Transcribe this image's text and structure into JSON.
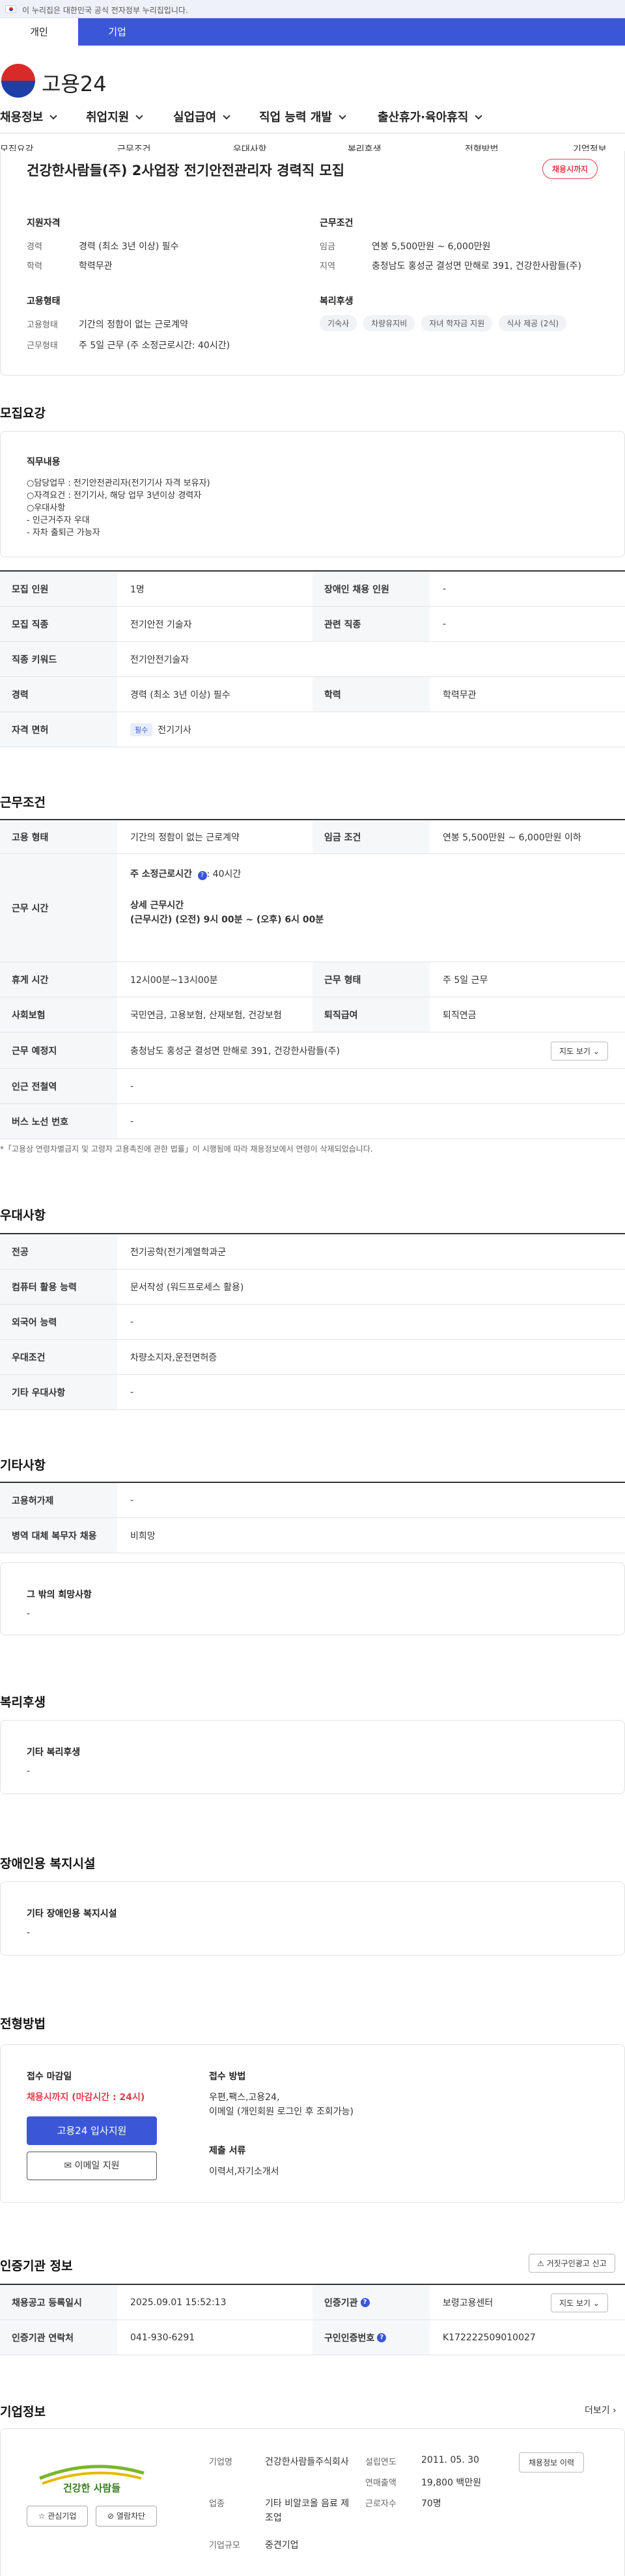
{
  "gov_banner": {
    "text": "이 누리집은 대한민국 공식 전자정부 누리집입니다."
  },
  "tabs": [
    {
      "label": "개인"
    },
    {
      "label": "기업"
    }
  ],
  "logo": {
    "text": "고용24"
  },
  "gnb": {
    "items": [
      {
        "label": "채용정보"
      },
      {
        "label": "취업지원"
      },
      {
        "label": "실업급여"
      },
      {
        "label": "직업 능력 개발"
      },
      {
        "label": "출산휴가·육아휴직"
      }
    ]
  },
  "subnav": {
    "items": [
      {
        "label": "모집요강"
      },
      {
        "label": "근무조건"
      },
      {
        "label": "우대사항"
      },
      {
        "label": "복리후생"
      },
      {
        "label": "전형방법"
      },
      {
        "label": "기업정보"
      }
    ]
  },
  "summary": {
    "title": "건강한사람들(주) 2사업장 전기안전관리자 경력직 모집",
    "status_badge": "채용시까지",
    "qualification": {
      "heading": "지원자격",
      "career_label": "경력",
      "career_value": "경력 (최소 3년 이상) 필수",
      "edu_label": "학력",
      "edu_value": "학력무관"
    },
    "conditions": {
      "heading": "근무조건",
      "wage_label": "임금",
      "wage_value": "연봉 5,500만원 ~ 6,000만원",
      "region_label": "지역",
      "region_value": "충청남도 홍성군 결성면 만해로 391, 건강한사람들(주)"
    },
    "employment": {
      "heading": "고용형태",
      "type_label": "고용형태",
      "type_value": "기간의 정함이 없는 근로계약",
      "form_label": "근무형태",
      "form_value": "주 5일 근무 (주 소정근로시간: 40시간)"
    },
    "welfare": {
      "heading": "복리후생",
      "tags": [
        "기숙사",
        "차량유지비",
        "자녀 학자금 지원",
        "식사 제공 (2식)"
      ]
    }
  },
  "recruit": {
    "heading": "모집요강",
    "duty_heading": "직무내용",
    "duty_lines": [
      "○담당업무 : 전기안전관리자(전기기사 자격 보유자)",
      "○자격요건 : 전기기사, 해당 업무 3년이상 경력자",
      "○우대사항",
      "- 인근거주자 우대",
      "- 자차 출퇴근 가능자"
    ],
    "rows": [
      {
        "th": "모집 인원",
        "td": "1명",
        "th2": "장애인 채용 인원",
        "td2": "-"
      },
      {
        "th": "모집 직종",
        "td": "전기안전 기술자",
        "th2": "관련 직종",
        "td2": "-"
      },
      {
        "th": "직종 키워드",
        "td": "전기안전기술자"
      },
      {
        "th": "경력",
        "td": "경력 (최소 3년 이상) 필수",
        "th2": "학력",
        "td2": "학력무관"
      },
      {
        "th": "자격 면허",
        "must": "필수",
        "td": "전기기사"
      }
    ]
  },
  "work": {
    "heading": "근무조건",
    "emp_label": "고용 형태",
    "emp_value": "기간의 정함이 없는 근로계약",
    "wage_label": "임금 조건",
    "wage_value": "연봉 5,500만원 ~ 6,000만원 이하",
    "hours_label": "근무 시간",
    "hours_weekly": "주 소정근로시간",
    "hours_weekly_value": ": 40시간",
    "hours_detail_title": "상세 근무시간",
    "hours_detail": "(근무시간) (오전) 9시 00분 ~ (오후) 6시 00분",
    "rest_label": "휴게 시간",
    "rest_value": "12시00분~13시00분",
    "form_label": "근무 형태",
    "form_value": "주 5일 근무",
    "insurance_label": "사회보험",
    "insurance_value": "국민연금, 고용보험, 산재보험, 건강보험",
    "retire_label": "퇴직급여",
    "retire_value": "퇴직연금",
    "place_label": "근무 예정지",
    "place_value": "충청남도 홍성군 결성면 만해로 391, 건강한사람들(주)",
    "map_button": "지도 보기",
    "subway_label": "인근 전철역",
    "subway_value": "-",
    "bus_label": "버스 노선 번호",
    "bus_value": "-",
    "note": "*「고용상 연령차별금지 및 고령자 고용촉진에 관한 법률」이 시행됨에 따라 채용정보에서 연령이 삭제되었습니다."
  },
  "prefer": {
    "heading": "우대사항",
    "rows": [
      {
        "th": "전공",
        "td": "전기공학(전기계열학과군"
      },
      {
        "th": "컴퓨터 활용 능력",
        "td": "문서작성 (워드프로세스 활용)"
      },
      {
        "th": "외국어 능력",
        "td": "-"
      },
      {
        "th": "우대조건",
        "td": "차량소지자,운전면허증"
      },
      {
        "th": "기타 우대사항",
        "td": "-"
      }
    ]
  },
  "etc": {
    "heading": "기타사항",
    "rows": [
      {
        "th": "고용허가제",
        "td": "-"
      },
      {
        "th": "병역 대체 복무자 채용",
        "td": "비희망"
      }
    ],
    "hope_title": "그 밖의 희망사항",
    "hope_value": "-"
  },
  "benefit": {
    "heading": "복리후생",
    "title": "기타 복리후생",
    "value": "-"
  },
  "disability": {
    "heading": "장애인용 복지시설",
    "title": "기타 장애인용 복지시설",
    "value": "-"
  },
  "selection": {
    "heading": "전형방법",
    "deadline_title": "접수 마감일",
    "deadline_value": "채용시까지 (마감시간 : 24시)",
    "apply_button": "고용24 입사지원",
    "email_button": "이메일 지원",
    "method_title": "접수 방법",
    "method_lines": [
      "우편,팩스,고용24,",
      "이메일 (개인회원 로그인 후 조회가능)"
    ],
    "docs_title": "제출 서류",
    "docs_value": "이력서,자기소개서"
  },
  "cert": {
    "heading": "인증기관 정보",
    "report_button": "거짓구인광고 신고",
    "reg_label": "채용공고 등록일시",
    "reg_value": "2025.09.01 15:52:13",
    "org_label": "인증기관",
    "org_value": "보령고용센터",
    "map_button": "지도 보기",
    "contact_label": "인증기관 연락처",
    "contact_value": "041-930-6291",
    "num_label": "구인인증번호",
    "num_value": "K172222509010027"
  },
  "company": {
    "heading": "기업정보",
    "more": "더보기",
    "logo_text": "건강한 사람들",
    "interest_button": "관심기업",
    "block_button": "열람차단",
    "name_label": "기업명",
    "name_value": "건강한사람들주식회사",
    "industry_label": "업종",
    "industry_value": "기타 비알코올 음료 제조업",
    "size_label": "기업규모",
    "size_value": "중견기업",
    "founded_label": "설립연도",
    "founded_value": "2011. 05. 30",
    "sales_label": "연매출액",
    "sales_value": "19,800 백만원",
    "staff_label": "근로자수",
    "staff_value": "70명",
    "history_button": "채용정보 이력"
  }
}
